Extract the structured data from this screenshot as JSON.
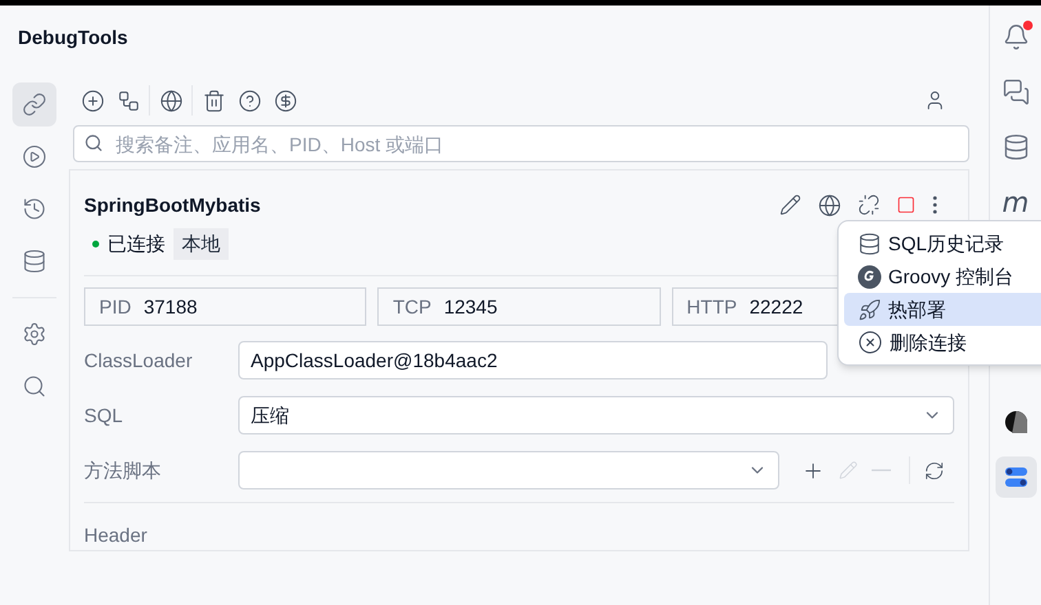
{
  "app_title": "DebugTools",
  "nav": [
    {
      "kind": "link",
      "selected": true
    },
    {
      "kind": "play",
      "selected": false
    },
    {
      "kind": "history",
      "selected": false
    },
    {
      "kind": "database",
      "selected": false
    },
    {
      "kind": "settings",
      "selected": false
    },
    {
      "kind": "search",
      "selected": false
    }
  ],
  "toolbar": [
    {
      "kind": "add"
    },
    {
      "kind": "flow"
    },
    {
      "kind": "globe"
    },
    {
      "kind": "delete"
    },
    {
      "kind": "help"
    },
    {
      "kind": "dollar"
    }
  ],
  "search": {
    "placeholder": "搜索备注、应用名、PID、Host 或端口"
  },
  "connection": {
    "name": "SpringBootMybatis",
    "status": "已连接",
    "connected": true,
    "tag": "本地",
    "info": [
      {
        "label": "PID",
        "value": "37188"
      },
      {
        "label": "TCP",
        "value": "12345"
      },
      {
        "label": "HTTP",
        "value": "22222"
      }
    ],
    "classloader": {
      "label": "ClassLoader",
      "value": "AppClassLoader@18b4aac2"
    },
    "sql": {
      "label": "SQL",
      "value": "压缩"
    },
    "script": {
      "label": "方法脚本"
    },
    "header": "Header"
  },
  "menu": [
    {
      "kind": "database",
      "label": "SQL历史记录",
      "selected": false
    },
    {
      "kind": "groovy",
      "label": "Groovy 控制台",
      "selected": false
    },
    {
      "kind": "rocket",
      "label": "热部署",
      "selected": true
    },
    {
      "kind": "remove",
      "label": "删除连接",
      "selected": false
    }
  ],
  "right_rail": [
    {
      "kind": "bell",
      "unread": true,
      "selected": false
    },
    {
      "kind": "chat",
      "unread": false,
      "selected": false
    },
    {
      "kind": "database",
      "unread": false,
      "selected": false
    },
    {
      "kind": "glyph",
      "glyph": "m",
      "unread": false,
      "selected": false
    },
    {
      "kind": "shape",
      "unread": false,
      "selected": false
    },
    {
      "kind": "toggles",
      "unread": false,
      "selected": true
    }
  ]
}
